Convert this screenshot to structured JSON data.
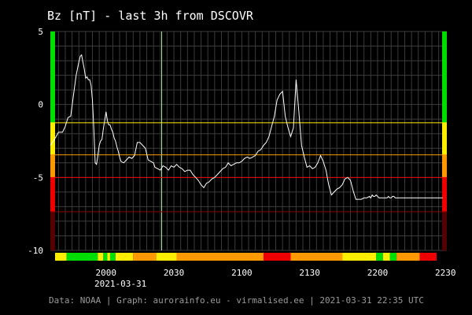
{
  "chart_data": {
    "type": "line",
    "title": "Bz [nT] - last 3h from DSCOVR",
    "date_label": "2021-03-31",
    "footer": "Data: NOAA | Graph: aurorainfo.eu - virmalised.ee | 2021-03-31 22:35 UTC",
    "xlim": [
      1941,
      2233
    ],
    "ylim": [
      -10,
      5
    ],
    "x_ticks": [
      {
        "value": 1982,
        "label": "2000"
      },
      {
        "value": 2032,
        "label": "2030"
      },
      {
        "value": 2082,
        "label": "2100"
      },
      {
        "value": 2132,
        "label": "2130"
      },
      {
        "value": 2182,
        "label": "2200"
      },
      {
        "value": 2232,
        "label": "2230"
      }
    ],
    "y_ticks": [
      {
        "value": 5,
        "label": "5"
      },
      {
        "value": 0,
        "label": "0"
      },
      {
        "value": -5,
        "label": "-5"
      },
      {
        "value": -10,
        "label": "-10"
      }
    ],
    "grid": true,
    "colors": {
      "line": "#ffffff",
      "grid": "#3c3c3c",
      "green": "#00dd00",
      "yellow": "#ffee00",
      "orange": "#ff9900",
      "red": "#ee0000",
      "darkred": "#550000",
      "gray": "#999999"
    },
    "threshold_lines": [
      {
        "value": -1.25,
        "color": "#ffee00"
      },
      {
        "value": -3.45,
        "color": "#ff9900"
      },
      {
        "value": -5.0,
        "color": "#ee0000"
      },
      {
        "value": -7.35,
        "color": "#880000"
      }
    ],
    "side_bands": [
      {
        "from": 5,
        "to": -1.25,
        "color": "#00dd00"
      },
      {
        "from": -1.25,
        "to": -3.45,
        "color": "#ffee00"
      },
      {
        "from": -3.45,
        "to": -5.0,
        "color": "#ff9900"
      },
      {
        "from": -5.0,
        "to": -7.35,
        "color": "#ee0000"
      },
      {
        "from": -7.35,
        "to": -10,
        "color": "#550000"
      }
    ],
    "status_bar": [
      {
        "from": 1941,
        "to": 1953,
        "color": "#ffee00"
      },
      {
        "from": 1953,
        "to": 1976,
        "color": "#00dd00"
      },
      {
        "from": 1976,
        "to": 1980,
        "color": "#ffee00"
      },
      {
        "from": 1980,
        "to": 1983,
        "color": "#00dd00"
      },
      {
        "from": 1983,
        "to": 1985,
        "color": "#ffee00"
      },
      {
        "from": 1985,
        "to": 1989,
        "color": "#00dd00"
      },
      {
        "from": 1989,
        "to": 2002,
        "color": "#ffee00"
      },
      {
        "from": 2002,
        "to": 2019,
        "color": "#ff9900"
      },
      {
        "from": 2019,
        "to": 2034,
        "color": "#ffee00"
      },
      {
        "from": 2034,
        "to": 2098,
        "color": "#ff9900"
      },
      {
        "from": 2098,
        "to": 2118,
        "color": "#ee0000"
      },
      {
        "from": 2118,
        "to": 2156,
        "color": "#ff9900"
      },
      {
        "from": 2156,
        "to": 2181,
        "color": "#ffee00"
      },
      {
        "from": 2181,
        "to": 2186,
        "color": "#00dd00"
      },
      {
        "from": 2186,
        "to": 2191,
        "color": "#ffee00"
      },
      {
        "from": 2191,
        "to": 2196,
        "color": "#00dd00"
      },
      {
        "from": 2196,
        "to": 2213,
        "color": "#ff9900"
      },
      {
        "from": 2213,
        "to": 2226,
        "color": "#ee0000"
      },
      {
        "from": 2226,
        "to": 2228,
        "color": "#ff9900"
      },
      {
        "from": 2228,
        "to": 2233,
        "color": "#999999"
      }
    ],
    "series": [
      {
        "x": [
          1941,
          1944,
          1947,
          1950,
          1952,
          1954,
          1956,
          1958,
          1960,
          1962,
          1963,
          1964,
          1965,
          1966,
          1967,
          1968,
          1969,
          1970,
          1971,
          1972,
          1973,
          1974,
          1975,
          1976,
          1977,
          1978,
          1979,
          1980,
          1981,
          1982,
          1983,
          1984,
          1985,
          1986,
          1987,
          1988,
          1989,
          1990,
          1991,
          1992,
          1993,
          1995,
          1997,
          1999,
          2001,
          2003,
          2005,
          2007,
          2009,
          2011,
          2013,
          2015,
          2017,
          2018,
          2020,
          2022,
          2024,
          2026,
          2028,
          2030,
          2032,
          2034,
          2036,
          2038,
          2040,
          2042,
          2044,
          2046,
          2048,
          2050,
          2052,
          2054,
          2056,
          2058,
          2060,
          2062,
          2064,
          2066,
          2068,
          2070,
          2072,
          2074,
          2076,
          2078,
          2080,
          2082,
          2084,
          2086,
          2088,
          2090,
          2092,
          2094,
          2096,
          2098,
          2100,
          2102,
          2104,
          2106,
          2108,
          2110,
          2112,
          2114,
          2116,
          2118,
          2120,
          2122,
          2124,
          2126,
          2128,
          2130,
          2132,
          2134,
          2136,
          2138,
          2140,
          2142,
          2144,
          2146,
          2148,
          2150,
          2152,
          2154,
          2156,
          2158,
          2160,
          2162,
          2164,
          2166,
          2168,
          2170,
          2172,
          2174,
          2176,
          2177,
          2178,
          2179,
          2180,
          2181,
          2182,
          2183,
          2184,
          2185,
          2186,
          2187,
          2188,
          2189,
          2190,
          2191,
          2192,
          2193,
          2194,
          2195,
          2196,
          2198,
          2200,
          2202,
          2204,
          2206,
          2208,
          2210,
          2212,
          2213,
          2214,
          2215,
          2216,
          2218,
          2220,
          2222,
          2223,
          2224,
          2225,
          2226,
          2227,
          2228,
          2229,
          2230
        ],
        "y": [
          -2.8,
          -2.4,
          -1.9,
          -1.9,
          -1.5,
          -0.9,
          -0.8,
          0.6,
          2.0,
          2.9,
          3.3,
          3.4,
          2.9,
          2.4,
          1.8,
          1.9,
          1.7,
          1.7,
          1.3,
          0.3,
          -1.6,
          -4.0,
          -4.1,
          -3.5,
          -2.8,
          -2.5,
          -2.4,
          -1.7,
          -1.1,
          -0.5,
          -1.1,
          -1.4,
          -1.4,
          -1.7,
          -1.9,
          -2.3,
          -2.5,
          -2.9,
          -3.2,
          -3.6,
          -3.9,
          -4.0,
          -3.8,
          -3.6,
          -3.7,
          -3.5,
          -2.6,
          -2.6,
          -2.8,
          -3.0,
          -3.8,
          -3.9,
          -4.0,
          -4.3,
          -4.4,
          -4.5,
          -4.2,
          -4.3,
          -4.5,
          -4.2,
          -4.3,
          -4.1,
          -4.3,
          -4.4,
          -4.6,
          -4.5,
          -4.5,
          -4.8,
          -5.0,
          -5.2,
          -5.5,
          -5.7,
          -5.4,
          -5.3,
          -5.1,
          -5.0,
          -4.8,
          -4.6,
          -4.4,
          -4.3,
          -4.0,
          -4.2,
          -4.1,
          -4.0,
          -4.0,
          -3.9,
          -3.7,
          -3.6,
          -3.7,
          -3.6,
          -3.5,
          -3.2,
          -3.1,
          -2.8,
          -2.6,
          -2.2,
          -1.5,
          -0.8,
          0.3,
          0.7,
          0.9,
          -0.8,
          -1.6,
          -2.2,
          -1.6,
          1.7,
          -0.5,
          -2.8,
          -3.6,
          -4.3,
          -4.2,
          -4.4,
          -4.3,
          -4.0,
          -3.5,
          -3.9,
          -4.5,
          -5.5,
          -6.2,
          -6.0,
          -5.8,
          -5.7,
          -5.5,
          -5.1,
          -5.0,
          -5.2,
          -5.9,
          -6.5,
          -6.5,
          -6.5,
          -6.4,
          -6.4,
          -6.3,
          -6.4,
          -6.2,
          -6.3,
          -6.3,
          -6.2,
          -6.3,
          -6.4,
          -6.4,
          -6.4,
          -6.4,
          -6.4,
          -6.4,
          -6.4,
          -6.3,
          -6.4,
          -6.4,
          -6.3,
          -6.3,
          -6.4,
          -6.4,
          -6.4,
          -6.4,
          -6.4,
          -6.4,
          -6.4,
          -6.4,
          -6.4,
          -6.4,
          -6.4,
          -6.4,
          -6.4,
          -6.4,
          -6.4,
          -6.4,
          -6.4,
          -6.4,
          -6.4,
          -6.4,
          -6.4,
          -6.4,
          -6.4,
          -6.4,
          -6.4
        ]
      }
    ]
  }
}
